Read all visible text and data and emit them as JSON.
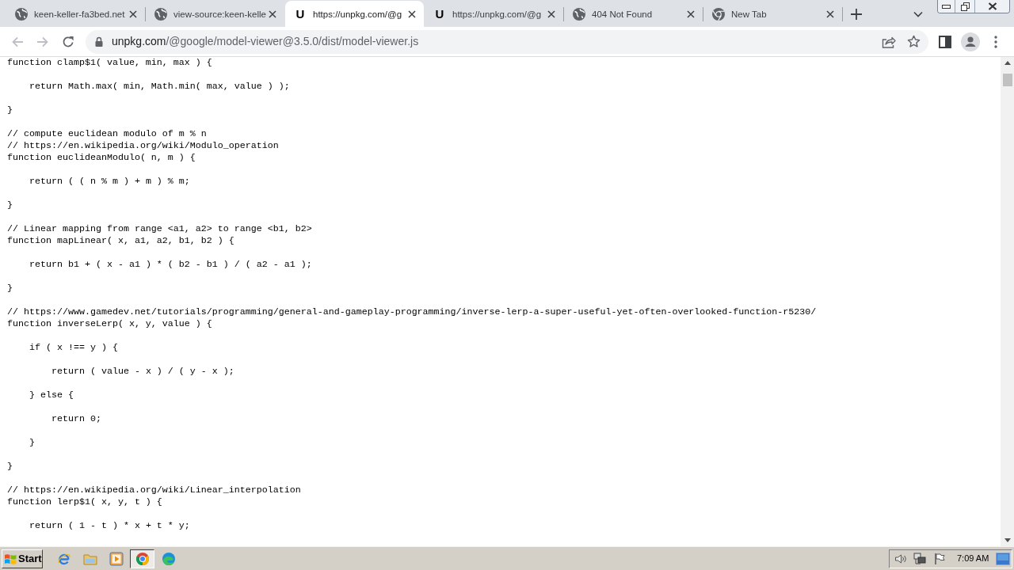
{
  "tab_strip": {
    "tabs": [
      {
        "kind": "globe",
        "title": "keen-keller-fa3bed.net",
        "selected": false
      },
      {
        "kind": "globe",
        "title": "view-source:keen-kelle",
        "selected": false
      },
      {
        "kind": "letter",
        "letter": "U",
        "title": "https://unpkg.com/@g",
        "selected": true
      },
      {
        "kind": "letter",
        "letter": "U",
        "title": "https://unpkg.com/@g",
        "selected": false
      },
      {
        "kind": "globe",
        "title": "404 Not Found",
        "selected": false
      },
      {
        "kind": "newtab",
        "title": "New Tab",
        "selected": false
      }
    ]
  },
  "toolbar": {
    "back": {
      "disabled": true
    },
    "forward": {
      "disabled": true
    },
    "url": {
      "host": "unpkg.com",
      "path": "/@google/model-viewer@3.5.0/dist/model-viewer.js"
    }
  },
  "code_blocks": [
    [
      "function clamp$1( value, min, max ) {"
    ],
    [
      "\treturn Math.max( min, Math.min( max, value ) );"
    ],
    [
      "}"
    ],
    [
      "// compute euclidean modulo of m % n",
      "// https://en.wikipedia.org/wiki/Modulo_operation",
      "function euclideanModulo( n, m ) {"
    ],
    [
      "\treturn ( ( n % m ) + m ) % m;"
    ],
    [
      "}"
    ],
    [
      "// Linear mapping from range <a1, a2> to range <b1, b2>",
      "function mapLinear( x, a1, a2, b1, b2 ) {"
    ],
    [
      "\treturn b1 + ( x - a1 ) * ( b2 - b1 ) / ( a2 - a1 );"
    ],
    [
      "}"
    ],
    [
      "// https://www.gamedev.net/tutorials/programming/general-and-gameplay-programming/inverse-lerp-a-super-useful-yet-often-overlooked-function-r5230/",
      "function inverseLerp( x, y, value ) {"
    ],
    [
      "\tif ( x !== y ) {"
    ],
    [
      "\t\treturn ( value - x ) / ( y - x );"
    ],
    [
      "\t} else {"
    ],
    [
      "\t\treturn 0;"
    ],
    [
      "\t}"
    ],
    [
      "}"
    ],
    [
      "// https://en.wikipedia.org/wiki/Linear_interpolation",
      "function lerp$1( x, y, t ) {"
    ],
    [
      "\treturn ( 1 - t ) * x + t * y;"
    ]
  ],
  "taskbar": {
    "start_label": "Start",
    "apps": [
      {
        "kind": "ie",
        "selected": false
      },
      {
        "kind": "folder",
        "selected": false
      },
      {
        "kind": "player",
        "selected": false
      },
      {
        "kind": "chrome",
        "selected": true
      },
      {
        "kind": "edge",
        "selected": false
      }
    ],
    "clock": "7:09 AM"
  }
}
